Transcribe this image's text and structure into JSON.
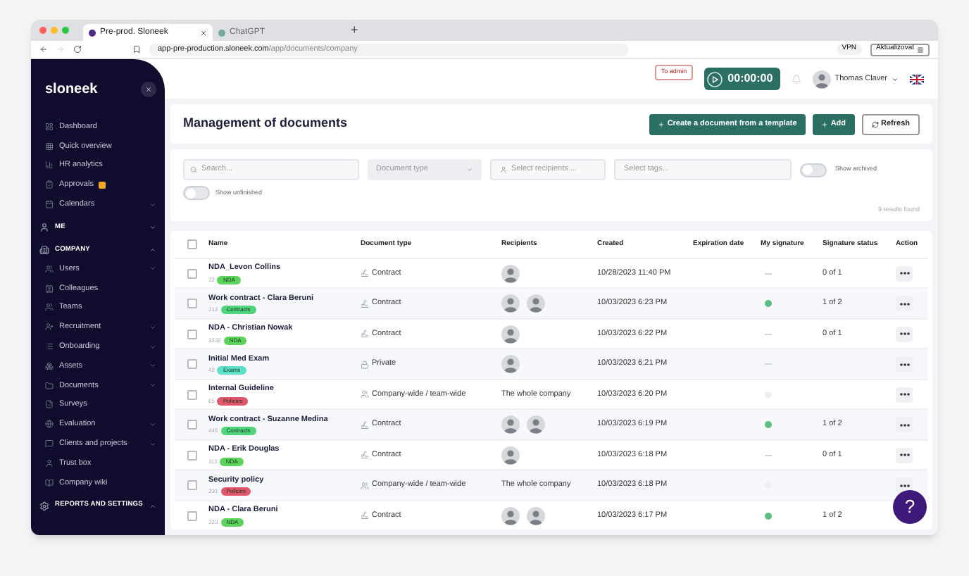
{
  "browser": {
    "tabs": [
      {
        "label": "Pre-prod. Sloneek",
        "selected": true
      },
      {
        "label": "ChatGPT",
        "selected": false
      }
    ],
    "new_tab": "+",
    "url_host": "app-pre-production.sloneek.com",
    "url_path": "/app/documents/company",
    "vpn": "VPN",
    "update_button": "Aktualizovat"
  },
  "sidebar": {
    "logo": "sloneek",
    "items": [
      {
        "kind": "item",
        "label": "Dashboard",
        "expandable": false
      },
      {
        "kind": "item",
        "label": "Quick overview",
        "expandable": false
      },
      {
        "kind": "item",
        "label": "HR analytics",
        "expandable": false
      },
      {
        "kind": "item",
        "label": "Approvals",
        "expandable": false,
        "badge": true
      },
      {
        "kind": "item",
        "label": "Calendars",
        "expandable": true
      },
      {
        "kind": "section",
        "label": "ME",
        "expanded": false
      },
      {
        "kind": "section",
        "label": "COMPANY",
        "expanded": true
      },
      {
        "kind": "item",
        "label": "Users",
        "expandable": true
      },
      {
        "kind": "item",
        "label": "Colleagues",
        "expandable": false
      },
      {
        "kind": "item",
        "label": "Teams",
        "expandable": false
      },
      {
        "kind": "item",
        "label": "Recruitment",
        "expandable": true
      },
      {
        "kind": "item",
        "label": "Onboarding",
        "expandable": true
      },
      {
        "kind": "item",
        "label": "Assets",
        "expandable": true
      },
      {
        "kind": "item",
        "label": "Documents",
        "expandable": true
      },
      {
        "kind": "item",
        "label": "Surveys",
        "expandable": false
      },
      {
        "kind": "item",
        "label": "Evaluation",
        "expandable": true
      },
      {
        "kind": "item",
        "label": "Clients and projects",
        "expandable": true
      },
      {
        "kind": "item",
        "label": "Trust box",
        "expandable": false
      },
      {
        "kind": "item",
        "label": "Company wiki",
        "expandable": false
      },
      {
        "kind": "section",
        "label": "REPORTS AND SETTINGS",
        "expanded": true
      }
    ]
  },
  "topbar": {
    "admin_badge": "To admin",
    "timer": "00:00:00",
    "user": "Thomas Claver"
  },
  "header": {
    "title": "Management of documents",
    "buttons": [
      {
        "label": "Create a document from a template",
        "kind": "primary"
      },
      {
        "label": "Add",
        "kind": "primary"
      },
      {
        "label": "Refresh",
        "kind": "outline"
      }
    ]
  },
  "filters": {
    "search": {
      "placeholder": "Search..."
    },
    "document_type": {
      "placeholder": "Document type"
    },
    "recipients": {
      "placeholder": "Select recipients ..."
    },
    "tags": {
      "placeholder": "Select tags..."
    },
    "show_archived": {
      "label": "Show archived",
      "on": false
    },
    "show_unfinished": {
      "label": "Show unfinished",
      "on": false
    },
    "results": "9 results found"
  },
  "table": {
    "select_all": {
      "checked": false
    },
    "columns": [
      "Name",
      "Document type",
      "Recipients",
      "Created",
      "Expiration date",
      "My signature",
      "Signature status",
      "Action"
    ],
    "rows": [
      {
        "name": "NDA_Levon Collins",
        "number": "32",
        "tag": {
          "label": "NDA",
          "color": "#5cd45c"
        },
        "type": {
          "label": "Contract",
          "kind": "contract"
        },
        "recipients": [
          {
            "kind": "avatar"
          }
        ],
        "created": "10/28/2023 11:40 PM",
        "my_signature": {
          "kind": "none"
        },
        "signature_status": "0 of 1",
        "action": true,
        "selected": false
      },
      {
        "name": "Work contract - Clara Beruni",
        "number": "212",
        "tag": {
          "label": "Contracts",
          "color": "#4fd67a"
        },
        "type": {
          "label": "Contract",
          "kind": "contract"
        },
        "recipients": [
          {
            "kind": "avatar"
          },
          {
            "kind": "avatar"
          }
        ],
        "created": "10/03/2023 6:23 PM",
        "my_signature": {
          "kind": "signed"
        },
        "signature_status": "1 of 2",
        "action": true,
        "selected": false
      },
      {
        "name": "NDA - Christian Nowak",
        "number": "3232",
        "tag": {
          "label": "NDA",
          "color": "#5cd45c"
        },
        "type": {
          "label": "Contract",
          "kind": "contract"
        },
        "recipients": [
          {
            "kind": "avatar"
          }
        ],
        "created": "10/03/2023 6:22 PM",
        "my_signature": {
          "kind": "none"
        },
        "signature_status": "0 of 1",
        "action": true,
        "selected": false
      },
      {
        "name": "Initial Med Exam",
        "number": "42",
        "tag": {
          "label": "Exams",
          "color": "#5ee0c8"
        },
        "type": {
          "label": "Private",
          "kind": "private"
        },
        "recipients": [
          {
            "kind": "avatar"
          }
        ],
        "created": "10/03/2023 6:21 PM",
        "my_signature": {
          "kind": "none"
        },
        "action": true,
        "selected": false
      },
      {
        "name": "Internal Guideline",
        "number": "65",
        "tag": {
          "label": "Policies",
          "color": "#e0566a"
        },
        "type": {
          "label": "Company-wide / team-wide",
          "kind": "company"
        },
        "recipients": [
          {
            "kind": "text",
            "text": "The whole company"
          }
        ],
        "created": "10/03/2023 6:20 PM",
        "my_signature": {
          "kind": "unsigned"
        },
        "action": true,
        "selected": false
      },
      {
        "name": "Work contract - Suzanne Medina",
        "number": "445",
        "tag": {
          "label": "Contracts",
          "color": "#4fd67a"
        },
        "type": {
          "label": "Contract",
          "kind": "contract"
        },
        "recipients": [
          {
            "kind": "avatar"
          },
          {
            "kind": "avatar"
          }
        ],
        "created": "10/03/2023 6:19 PM",
        "my_signature": {
          "kind": "signed"
        },
        "signature_status": "1 of 2",
        "action": true,
        "selected": false
      },
      {
        "name": "NDA - Erik Douglas",
        "number": "113",
        "tag": {
          "label": "NDA",
          "color": "#5cd45c"
        },
        "type": {
          "label": "Contract",
          "kind": "contract"
        },
        "recipients": [
          {
            "kind": "avatar"
          }
        ],
        "created": "10/03/2023 6:18 PM",
        "my_signature": {
          "kind": "none"
        },
        "signature_status": "0 of 1",
        "action": true,
        "selected": false
      },
      {
        "name": "Security policy",
        "number": "231",
        "tag": {
          "label": "Policies",
          "color": "#e0566a"
        },
        "type": {
          "label": "Company-wide / team-wide",
          "kind": "company"
        },
        "recipients": [
          {
            "kind": "text",
            "text": "The whole company"
          }
        ],
        "created": "10/03/2023 6:18 PM",
        "my_signature": {
          "kind": "unsigned"
        },
        "action": true,
        "selected": false
      },
      {
        "name": "NDA - Clara Beruni",
        "number": "323",
        "tag": {
          "label": "NDA",
          "color": "#5cd45c"
        },
        "type": {
          "label": "Contract",
          "kind": "contract"
        },
        "recipients": [
          {
            "kind": "avatar"
          },
          {
            "kind": "avatar"
          }
        ],
        "created": "10/03/2023 6:17 PM",
        "my_signature": {
          "kind": "signed"
        },
        "signature_status": "1 of 2",
        "action": false,
        "selected": false
      }
    ]
  },
  "help_button": "?"
}
